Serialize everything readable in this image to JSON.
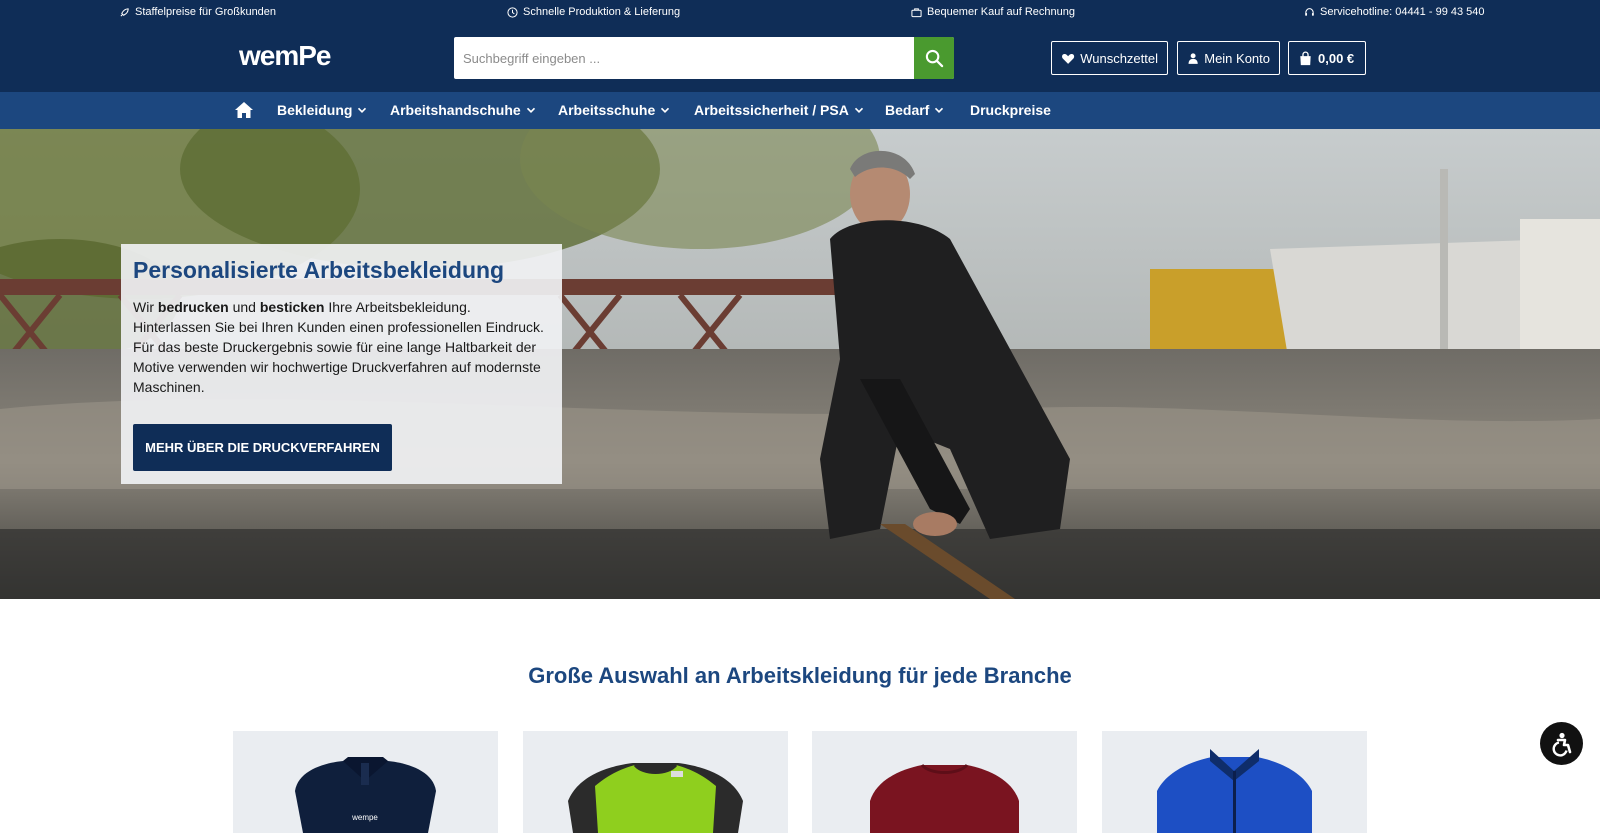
{
  "topbar": {
    "item1": "Staffelpreise für Großkunden",
    "item2": "Schnelle Produktion & Lieferung",
    "item3": "Bequemer Kauf auf Rechnung",
    "item4": "Servicehotline: 04441 - 99 43 540"
  },
  "header": {
    "logo": "wemPe",
    "search_placeholder": "Suchbegriff eingeben ...",
    "wishlist": "Wunschzettel",
    "account": "Mein Konto",
    "cart": "0,00 €"
  },
  "nav": {
    "items": [
      "Bekleidung",
      "Arbeitshandschuhe",
      "Arbeitsschuhe",
      "Arbeitssicherheit / PSA",
      "Bedarf",
      "Druckpreise"
    ]
  },
  "hero": {
    "title": "Personalisierte Arbeitsbekleidung",
    "text_1": "Wir ",
    "text_bold_1": "bedrucken",
    "text_2": " und ",
    "text_bold_2": "besticken",
    "text_3": " Ihre Arbeitsbekleidung. Hinterlassen Sie bei Ihren Kunden einen professionellen Eindruck. Für das beste Druckergebnis sowie für eine lange Haltbarkeit der Motive verwenden wir hochwertige Druckverfahren auf modernste Maschinen.",
    "cta": "MEHR ÜBER DIE DRUCKVERFAHREN"
  },
  "section": {
    "title": "Große Auswahl an Arbeitskleidung für jede Branche"
  },
  "products": [
    {
      "kind": "polo",
      "color": "#0f1f3c",
      "print": "wempe"
    },
    {
      "kind": "tshirt",
      "color": "#8fcf1e",
      "accent": "#2b2b2b"
    },
    {
      "kind": "sweatshirt",
      "color": "#7a1420"
    },
    {
      "kind": "jacket",
      "color": "#1d4fc4"
    }
  ],
  "colors": {
    "primary": "#0f2d57",
    "nav": "#1c477f",
    "search_button": "#4a9a2f"
  }
}
